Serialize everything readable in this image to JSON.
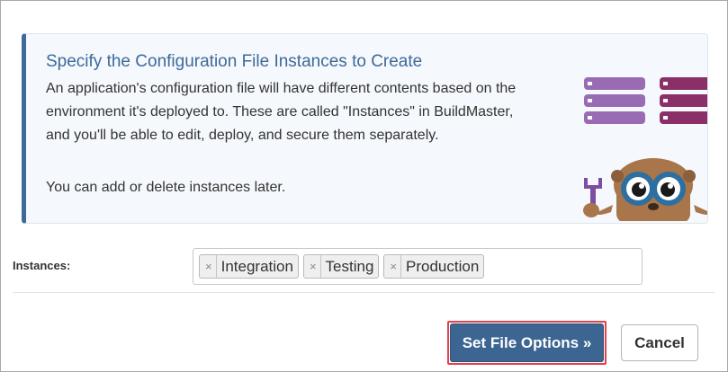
{
  "info": {
    "title": "Specify the Configuration File Instances to Create",
    "body": "An application's configuration file will have different contents based on the environment it's deployed to. These are called \"Instances\" in BuildMaster, and you'll be able to edit, deploy, and secure them separately.",
    "body2": "You can add or delete instances later.",
    "illustration": "buildmaster-otter-mascot-with-servers"
  },
  "instances": {
    "label": "Instances:",
    "tags": [
      {
        "remove_glyph": "×",
        "label": "Integration"
      },
      {
        "remove_glyph": "×",
        "label": "Testing"
      },
      {
        "remove_glyph": "×",
        "label": "Production"
      }
    ]
  },
  "actions": {
    "primary_label": "Set File Options »",
    "cancel_label": "Cancel"
  },
  "colors": {
    "accent": "#3d6a9a",
    "primary_button": "#3d6592",
    "highlight": "#e0414e",
    "server_purple": "#9a6bb5",
    "server_magenta": "#8a2f68",
    "mascot_brown": "#a8764a"
  }
}
